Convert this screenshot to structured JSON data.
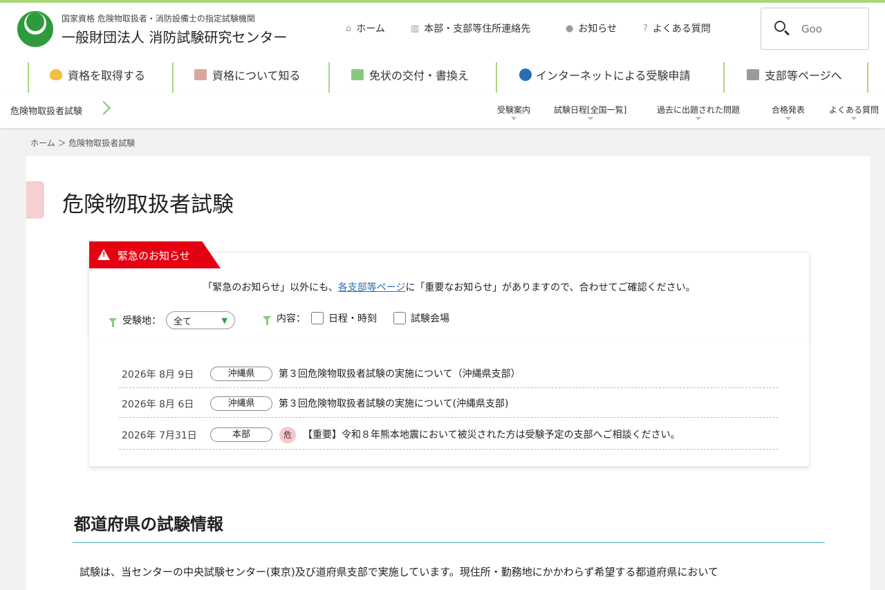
{
  "header": {
    "org_sub": "国家資格 危険物取扱者・消防設備士の指定試験機関",
    "org_name": "一般財団法人 消防試験研究センター",
    "util_links": [
      {
        "label": "ホーム",
        "icon": "home-icon"
      },
      {
        "label": "本部・支部等住所連絡先",
        "icon": "map-icon"
      },
      {
        "label": "お知らせ",
        "icon": "info-icon"
      },
      {
        "label": "よくある質問",
        "icon": "question-icon"
      }
    ],
    "search_placeholder": "Goo"
  },
  "gnav": [
    {
      "label": "資格を取得する",
      "icon": "hand-icon",
      "icon_color": "#f0c040"
    },
    {
      "label": "資格について知る",
      "icon": "person-icon",
      "icon_color": "#d8a8a0"
    },
    {
      "label": "免状の交付・書換え",
      "icon": "license-card-icon",
      "icon_color": "#8ac77e"
    },
    {
      "label": "インターネットによる受験申請",
      "icon": "document-icon",
      "icon_color": "#2a6eb8"
    },
    {
      "label": "支部等ページへ",
      "icon": "map-icon",
      "icon_color": "#9a9a9a"
    }
  ],
  "subnav": {
    "title": "危険物取扱者試験",
    "items": [
      "受験案内",
      "試験日程[全国一覧]",
      "過去に出題された問題",
      "合格発表",
      "よくある質問"
    ]
  },
  "breadcrumb": "ホーム ＞ 危険物取扱者試験",
  "page_title": "危険物取扱者試験",
  "notice": {
    "tab_label": "緊急のお知らせ",
    "msg_before": "「緊急のお知らせ」以外にも、",
    "msg_link": "各支部等ページ",
    "msg_after": "に「重要なお知らせ」がありますので、合わせてご確認ください。",
    "filter_place_label": "受験地：",
    "filter_place_value": "全て",
    "filter_content_label": "内容：",
    "checkbox_schedule": "日程・時刻",
    "checkbox_venue": "試験会場"
  },
  "news": [
    {
      "date": "2026年 8月 9日",
      "tag": "沖縄県",
      "text": "第３回危険物取扱者試験の実施について（沖縄県支部）",
      "badge": ""
    },
    {
      "date": "2026年 8月 6日",
      "tag": "沖縄県",
      "text": "第３回危険物取扱者試験の実施について(沖縄県支部)",
      "badge": ""
    },
    {
      "date": "2026年 7月31日",
      "tag": "本部",
      "text": "【重要】令和８年熊本地震において被災された方は受験予定の支部へご相談ください。",
      "badge": "危"
    }
  ],
  "section": {
    "title": "都道府県の試験情報",
    "body": "試験は、当センターの中央試験センター(東京)及び道府県支部で実施しています。現住所・勤務地にかかわらず希望する都道府県において"
  },
  "colors": {
    "accent_green": "#2e9a3c",
    "urgent_red": "#e50012",
    "nav_separator": "#a8d878"
  }
}
